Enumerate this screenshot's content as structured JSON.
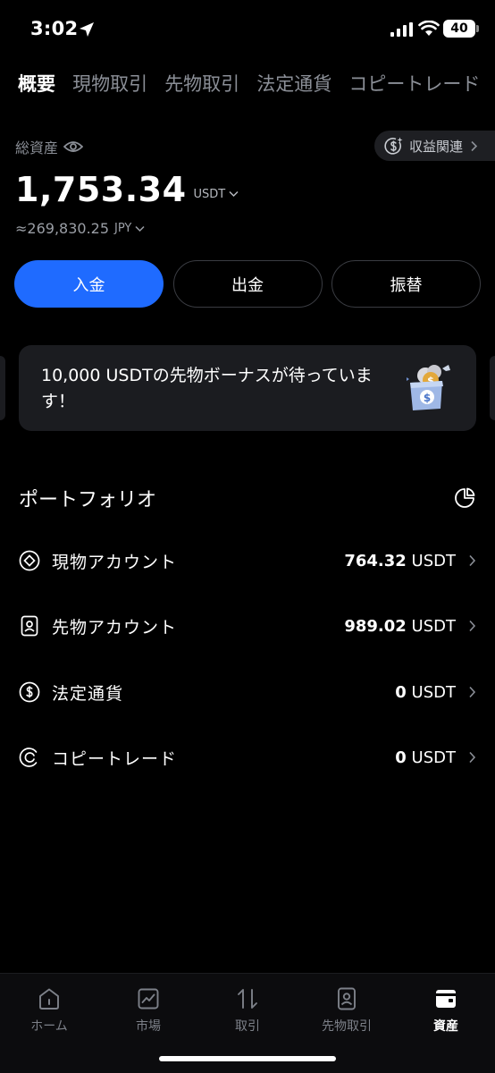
{
  "status_bar": {
    "time": "3:02",
    "battery": "40"
  },
  "top_tabs": [
    {
      "label": "概要",
      "active": true
    },
    {
      "label": "現物取引",
      "active": false
    },
    {
      "label": "先物取引",
      "active": false
    },
    {
      "label": "法定通貨",
      "active": false
    },
    {
      "label": "コピートレード",
      "active": false
    }
  ],
  "assets": {
    "total_label": "総資産",
    "earnings_label": "収益関連",
    "total_value": "1,753.34",
    "total_unit": "USDT",
    "approx_value": "≈269,830.25",
    "approx_unit": "JPY"
  },
  "actions": {
    "deposit": "入金",
    "withdraw": "出金",
    "transfer": "振替"
  },
  "banner": {
    "text": "10,000 USDTの先物ボーナスが待っています！"
  },
  "portfolio": {
    "title": "ポートフォリオ",
    "items": [
      {
        "label": "現物アカウント",
        "value": "764.32",
        "unit": "USDT"
      },
      {
        "label": "先物アカウント",
        "value": "989.02",
        "unit": "USDT"
      },
      {
        "label": "法定通貨",
        "value": "0",
        "unit": "USDT"
      },
      {
        "label": "コピートレード",
        "value": "0",
        "unit": "USDT"
      }
    ]
  },
  "bottom_nav": [
    {
      "label": "ホーム",
      "active": false
    },
    {
      "label": "市場",
      "active": false
    },
    {
      "label": "取引",
      "active": false
    },
    {
      "label": "先物取引",
      "active": false
    },
    {
      "label": "資産",
      "active": true
    }
  ],
  "colors": {
    "accent": "#1f6bff",
    "background": "#000000",
    "card": "#1b1c20",
    "muted_text": "#8b8f97"
  }
}
